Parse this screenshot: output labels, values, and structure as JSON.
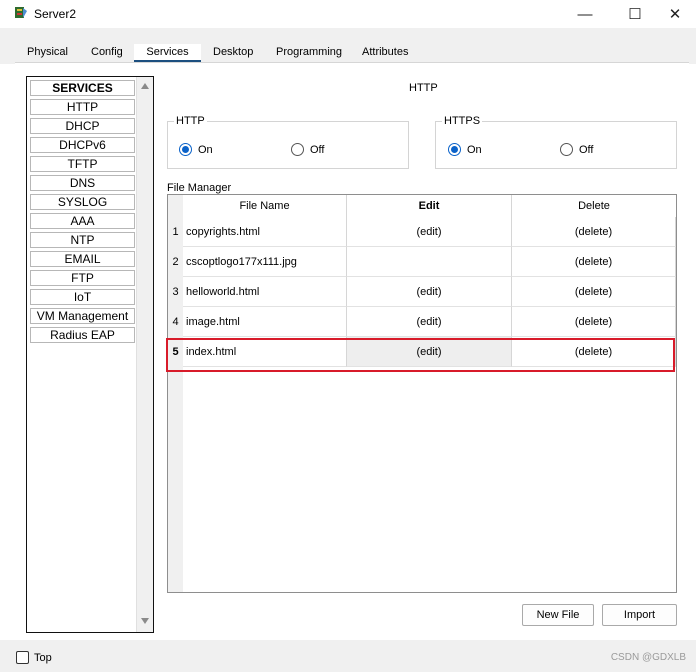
{
  "window": {
    "title": "Server2",
    "minimize_glyph": "—",
    "maximize_glyph": "☐",
    "close_glyph": "✕"
  },
  "tabs": [
    {
      "label": "Physical"
    },
    {
      "label": "Config"
    },
    {
      "label": "Services"
    },
    {
      "label": "Desktop"
    },
    {
      "label": "Programming"
    },
    {
      "label": "Attributes"
    }
  ],
  "sidebar": {
    "items": [
      "SERVICES",
      "HTTP",
      "DHCP",
      "DHCPv6",
      "TFTP",
      "DNS",
      "SYSLOG",
      "AAA",
      "NTP",
      "EMAIL",
      "FTP",
      "IoT",
      "VM Management",
      "Radius EAP"
    ]
  },
  "panel": {
    "heading": "HTTP",
    "http_group": {
      "label": "HTTP",
      "on": "On",
      "off": "Off",
      "selected": "On"
    },
    "https_group": {
      "label": "HTTPS",
      "on": "On",
      "off": "Off",
      "selected": "On"
    },
    "file_manager_label": "File Manager"
  },
  "table": {
    "headers": [
      "File Name",
      "Edit",
      "Delete"
    ],
    "rows": [
      {
        "num": "1",
        "name": "copyrights.html",
        "edit": "(edit)",
        "delete": "(delete)"
      },
      {
        "num": "2",
        "name": "cscoptlogo177x111.jpg",
        "edit": "",
        "delete": "(delete)"
      },
      {
        "num": "3",
        "name": "helloworld.html",
        "edit": "(edit)",
        "delete": "(delete)"
      },
      {
        "num": "4",
        "name": "image.html",
        "edit": "(edit)",
        "delete": "(delete)"
      },
      {
        "num": "5",
        "name": "index.html",
        "edit": "(edit)",
        "delete": "(delete)"
      }
    ],
    "selected_row": "5"
  },
  "buttons": {
    "new_file": "New File",
    "import": "Import"
  },
  "footer": {
    "top_label": "Top",
    "watermark": "CSDN @GDXLB"
  },
  "colors": {
    "accent": "#0a62c9",
    "tab_underline": "#1c4f7f",
    "highlight": "#d81b2a"
  }
}
